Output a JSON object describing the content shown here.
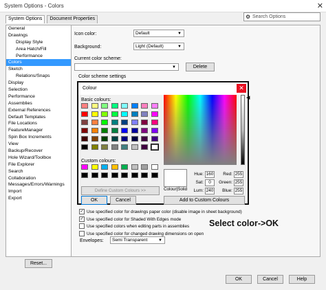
{
  "window": {
    "title": "System Options - Colors",
    "close_glyph": "✕"
  },
  "tabs": [
    {
      "label": "System Options"
    },
    {
      "label": "Document Properties"
    }
  ],
  "search": {
    "placeholder": "Search Options"
  },
  "tree": [
    {
      "label": "General",
      "level": 0
    },
    {
      "label": "Drawings",
      "level": 0
    },
    {
      "label": "Display Style",
      "level": 1
    },
    {
      "label": "Area Hatch/Fill",
      "level": 1
    },
    {
      "label": "Performance",
      "level": 1
    },
    {
      "label": "Colors",
      "level": 0,
      "selected": true
    },
    {
      "label": "Sketch",
      "level": 0
    },
    {
      "label": "Relations/Snaps",
      "level": 1
    },
    {
      "label": "Display",
      "level": 0
    },
    {
      "label": "Selection",
      "level": 0
    },
    {
      "label": "Performance",
      "level": 0
    },
    {
      "label": "Assemblies",
      "level": 0
    },
    {
      "label": "External References",
      "level": 0
    },
    {
      "label": "Default Templates",
      "level": 0
    },
    {
      "label": "File Locations",
      "level": 0
    },
    {
      "label": "FeatureManager",
      "level": 0
    },
    {
      "label": "Spin Box Increments",
      "level": 0
    },
    {
      "label": "View",
      "level": 0
    },
    {
      "label": "Backup/Recover",
      "level": 0
    },
    {
      "label": "Hole Wizard/Toolbox",
      "level": 0
    },
    {
      "label": "File Explorer",
      "level": 0
    },
    {
      "label": "Search",
      "level": 0
    },
    {
      "label": "Collaboration",
      "level": 0
    },
    {
      "label": "Messages/Errors/Warnings",
      "level": 0
    },
    {
      "label": "Import",
      "level": 0
    },
    {
      "label": "Export",
      "level": 0
    }
  ],
  "main": {
    "icon_color_label": "Icon color:",
    "icon_color_value": "Default",
    "background_label": "Background:",
    "background_value": "Light (Default)",
    "scheme_label": "Current color scheme:",
    "scheme_value": "",
    "delete_label": "Delete",
    "scheme_settings_label": "Color scheme settings"
  },
  "color_dialog": {
    "title": "Colour",
    "close_glyph": "✕",
    "basic_label": "Basic colours:",
    "custom_label": "Custom colours:",
    "define_label": "Define Custom Colours >>",
    "ok_label": "OK",
    "cancel_label": "Cancel",
    "solid_label": "Colour|Solid",
    "add_label": "Add to Custom Colours",
    "fields": {
      "hue_label": "Hue:",
      "hue": "160",
      "sat_label": "Sat:",
      "sat": "0",
      "lum_label": "Lum:",
      "lum": "240",
      "red_label": "Red:",
      "red": "255",
      "green_label": "Green:",
      "green": "255",
      "blue_label": "Blue:",
      "blue": "255"
    },
    "basic_colors": [
      "#ff8080",
      "#ffff80",
      "#80ff80",
      "#00ff80",
      "#80ffff",
      "#0080ff",
      "#ff80c0",
      "#ff80ff",
      "#ff0000",
      "#ffff00",
      "#80ff00",
      "#00ff40",
      "#00ffff",
      "#0080c0",
      "#8080c0",
      "#ff00ff",
      "#804040",
      "#ff8040",
      "#00ff00",
      "#008080",
      "#004080",
      "#8080ff",
      "#800040",
      "#ff0080",
      "#800000",
      "#ff8000",
      "#008000",
      "#008040",
      "#0000ff",
      "#0000a0",
      "#800080",
      "#8000ff",
      "#400000",
      "#804000",
      "#004000",
      "#004040",
      "#000080",
      "#000040",
      "#400040",
      "#400080",
      "#000000",
      "#808000",
      "#808040",
      "#808080",
      "#408080",
      "#c0c0c0",
      "#400040",
      "#ffffff"
    ],
    "custom_colors": [
      "#ff00ff",
      "#ffff00",
      "#00b0f0",
      "#ffc000",
      "#00b050",
      "#c0c0c0",
      "#a0a0a0",
      "#ffffff",
      "#000000",
      "#000000",
      "#000000",
      "#000000",
      "#000000",
      "#000000",
      "#000000",
      "#000000"
    ]
  },
  "options": [
    {
      "label": "Use specified color for drawings paper color (disable image in sheet background)",
      "checked": true
    },
    {
      "label": "Use specified color for Shaded With Edges mode",
      "checked": true
    },
    {
      "label": "Use specified colors when editing parts in assemblies",
      "checked": false
    },
    {
      "label": "Use specified color for changed drawing dimensions on open",
      "checked": false
    }
  ],
  "envelopes": {
    "label": "Envelopes:",
    "value": "Semi Transparent"
  },
  "reset_label": "Reset...",
  "footer": {
    "ok": "OK",
    "cancel": "Cancel",
    "help": "Help"
  },
  "annotation": "Select color->OK",
  "icons": {
    "search": "gear-search-icon",
    "dropdown": "chevron-down-icon"
  }
}
